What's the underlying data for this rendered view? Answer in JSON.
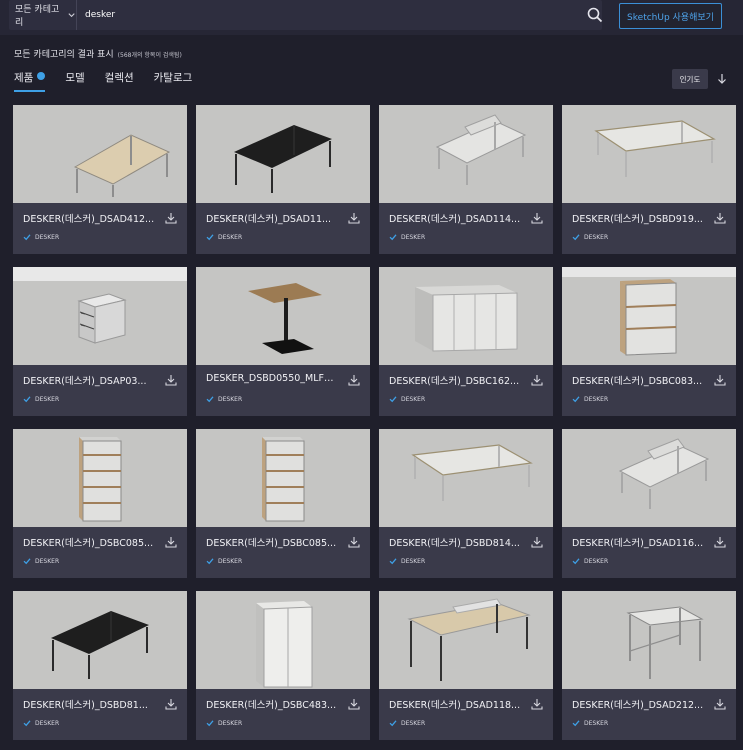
{
  "header": {
    "category_label": "모든 카테고리",
    "search_value": "desker",
    "sketchup_button": "SketchUp 사용해보기"
  },
  "results": {
    "title": "모든 카테고리의 결과 표시",
    "count_text": "(568개의 항목이 검색됨)"
  },
  "tabs": [
    {
      "label": "제품",
      "active": true
    },
    {
      "label": "모델",
      "active": false
    },
    {
      "label": "컬렉션",
      "active": false
    },
    {
      "label": "카탈로그",
      "active": false
    }
  ],
  "sort": {
    "label": "인기도"
  },
  "colors": {
    "accent": "#3ea0e6",
    "card_bg": "#3a3a4a",
    "page_bg": "#1f1f2b"
  },
  "cards": [
    {
      "title": "DESKER(데스커)_DSAD412...",
      "brand": "DESKER",
      "thumb": "desk-oak"
    },
    {
      "title": "DESKER(데스커)_DSAD11...",
      "brand": "DESKER",
      "thumb": "desk-black"
    },
    {
      "title": "DESKER(데스커)_DSAD114...",
      "brand": "DESKER",
      "thumb": "desk-white-panel"
    },
    {
      "title": "DESKER(데스커)_DSBD919...",
      "brand": "DESKER",
      "thumb": "desk-white"
    },
    {
      "title": "DESKER(데스커)_DSAP03...",
      "brand": "DESKER",
      "thumb": "pedestal"
    },
    {
      "title": "DESKER_DSBD0550_MLFK...",
      "brand": "DESKER",
      "thumb": "bar-table"
    },
    {
      "title": "DESKER(데스커)_DSBC162...",
      "brand": "DESKER",
      "thumb": "cabinet-wide"
    },
    {
      "title": "DESKER(데스커)_DSBC083...",
      "brand": "DESKER",
      "thumb": "shelf-low"
    },
    {
      "title": "DESKER(데스커)_DSBC085...",
      "brand": "DESKER",
      "thumb": "shelf-tall"
    },
    {
      "title": "DESKER(데스커)_DSBC085...",
      "brand": "DESKER",
      "thumb": "shelf-tall"
    },
    {
      "title": "DESKER(데스커)_DSBD814...",
      "brand": "DESKER",
      "thumb": "desk-white"
    },
    {
      "title": "DESKER(데스커)_DSAD116...",
      "brand": "DESKER",
      "thumb": "desk-white-panel"
    },
    {
      "title": "DESKER(데스커)_DSBD81...",
      "brand": "DESKER",
      "thumb": "desk-black"
    },
    {
      "title": "DESKER(데스커)_DSBC483...",
      "brand": "DESKER",
      "thumb": "cabinet-tall"
    },
    {
      "title": "DESKER(데스커)_DSAD118...",
      "brand": "DESKER",
      "thumb": "desk-oak-long"
    },
    {
      "title": "DESKER(데스커)_DSAD212...",
      "brand": "DESKER",
      "thumb": "desk-white-small"
    }
  ]
}
